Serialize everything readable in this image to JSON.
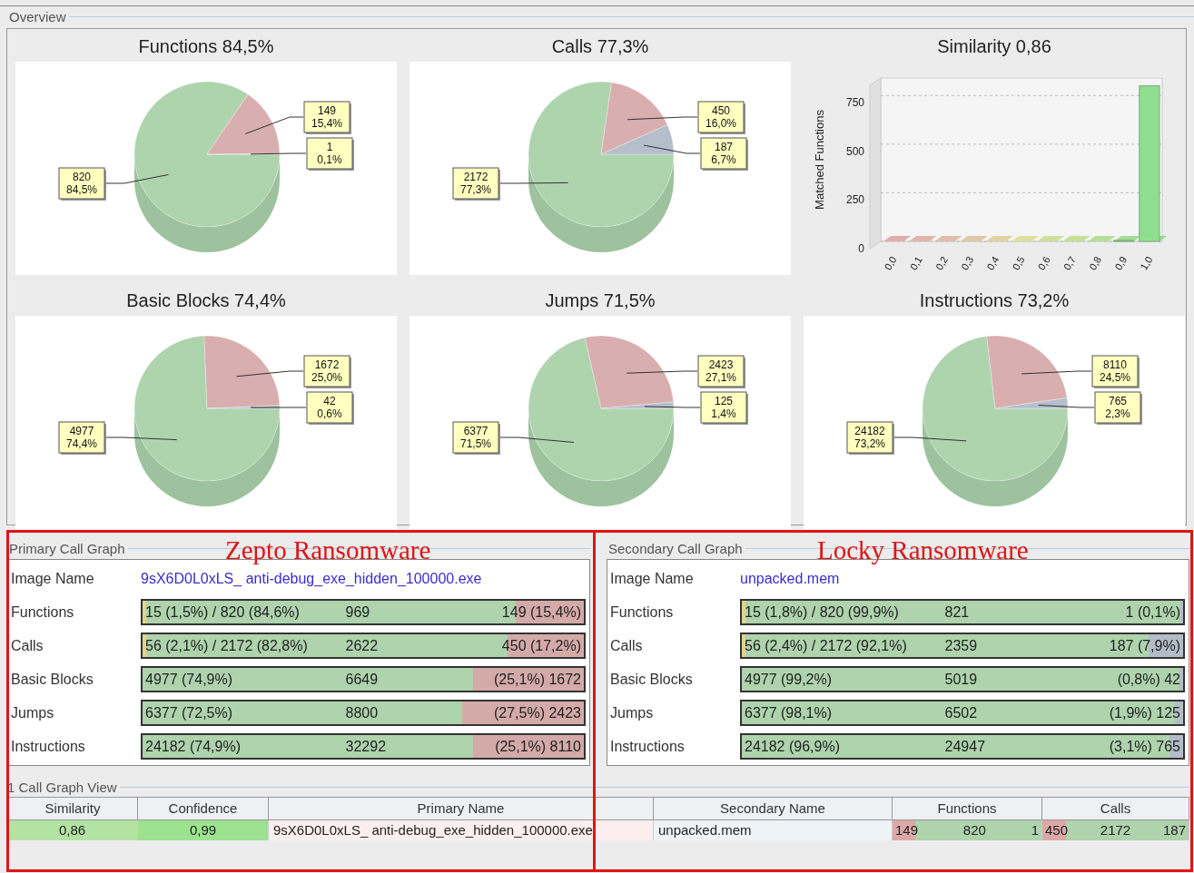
{
  "overview": {
    "title": "Overview",
    "charts": [
      {
        "chart_data": {
          "type": "pie",
          "title": "Functions 84,5%",
          "values": [
            820,
            149,
            1
          ],
          "value_labels": [
            "820\n84,5%",
            "149\n15,4%",
            "1\n0,1%"
          ]
        }
      },
      {
        "chart_data": {
          "type": "pie",
          "title": "Calls 77,3%",
          "values": [
            2172,
            450,
            187
          ],
          "value_labels": [
            "2172\n77,3%",
            "450\n16,0%",
            "187\n6,7%"
          ]
        }
      },
      {
        "chart_data": {
          "type": "bar",
          "title": "Similarity 0,86",
          "ylabel": "Matched Functions",
          "categories": [
            "0,0",
            "0,1",
            "0,2",
            "0,3",
            "0,4",
            "0,5",
            "0,6",
            "0,7",
            "0,8",
            "0,9",
            "1,0"
          ],
          "values": [
            0,
            0,
            0,
            0,
            0,
            0,
            0,
            0,
            0,
            5,
            800
          ],
          "ylim": [
            0,
            840
          ],
          "yticks": [
            0,
            250,
            500,
            750
          ],
          "grid": true
        }
      },
      {
        "chart_data": {
          "type": "pie",
          "title": "Basic Blocks 74,4%",
          "values": [
            4977,
            1672,
            42
          ],
          "value_labels": [
            "4977\n74,4%",
            "1672\n25,0%",
            "42\n0,6%"
          ]
        }
      },
      {
        "chart_data": {
          "type": "pie",
          "title": "Jumps 71,5%",
          "values": [
            6377,
            2423,
            125
          ],
          "value_labels": [
            "6377\n71,5%",
            "2423\n27,1%",
            "125\n1,4%"
          ]
        }
      },
      {
        "chart_data": {
          "type": "pie",
          "title": "Instructions 73,2%",
          "values": [
            24182,
            8110,
            765
          ],
          "value_labels": [
            "24182\n73,2%",
            "8110\n24,5%",
            "765\n2,3%"
          ]
        }
      }
    ]
  },
  "call_graphs": [
    {
      "kind": "primary",
      "title": "Primary Call Graph",
      "annotation": "Zepto Ransomware",
      "image_label": "Image Name",
      "image_name": "9sX6D0L0xLS_ anti-debug_exe_hidden_100000.exe",
      "rows": [
        {
          "label": "Functions",
          "left": "15 (1,5%) / 820 (84,6%)",
          "center": "969",
          "right": "149 (15,4%)",
          "level": 0.846,
          "marker": true
        },
        {
          "label": "Calls",
          "left": "56 (2,1%) / 2172 (82,8%)",
          "center": "2622",
          "right": "450 (17,2%)",
          "level": 0.828,
          "marker": true
        },
        {
          "label": "Basic Blocks",
          "left": "4977 (74,9%)",
          "center": "6649",
          "right": "(25,1%) 1672",
          "level": 0.749,
          "marker": false
        },
        {
          "label": "Jumps",
          "left": "6377 (72,5%)",
          "center": "8800",
          "right": "(27,5%) 2423",
          "level": 0.725,
          "marker": false
        },
        {
          "label": "Instructions",
          "left": "24182 (74,9%)",
          "center": "32292",
          "right": "(25,1%) 8110",
          "level": 0.749,
          "marker": false
        }
      ]
    },
    {
      "kind": "secondary",
      "title": "Secondary Call Graph",
      "annotation": "Locky Ransomware",
      "image_label": "Image Name",
      "image_name": "unpacked.mem",
      "rows": [
        {
          "label": "Functions",
          "left": "15 (1,8%) / 820 (99,9%)",
          "center": "821",
          "right": "1 (0,1%)",
          "level": 0.994,
          "marker": true
        },
        {
          "label": "Calls",
          "left": "56 (2,4%) / 2172 (92,1%)",
          "center": "2359",
          "right": "187 (7,9%)",
          "level": 0.921,
          "marker": true
        },
        {
          "label": "Basic Blocks",
          "left": "4977 (99,2%)",
          "center": "5019",
          "right": "(0,8%) 42",
          "level": 0.992,
          "marker": false
        },
        {
          "label": "Jumps",
          "left": "6377 (98,1%)",
          "center": "6502",
          "right": "(1,9%) 125",
          "level": 0.981,
          "marker": false
        },
        {
          "label": "Instructions",
          "left": "24182 (96,9%)",
          "center": "24947",
          "right": "(3,1%) 765",
          "level": 0.969,
          "marker": false
        }
      ]
    }
  ],
  "call_graph_view": {
    "title": "1 Call Graph View",
    "columns": [
      "Similarity",
      "Confidence",
      "Primary Name",
      "Secondary Name",
      "Functions",
      "Calls"
    ],
    "rows": [
      {
        "similarity": "0,86",
        "confidence": "0,99",
        "primary_name": "9sX6D0L0xLS_ anti-debug_exe_hidden_100000.exe",
        "secondary_name": "unpacked.mem",
        "functions": {
          "values": [
            "149",
            "820",
            "1"
          ],
          "level": 0.154
        },
        "calls": {
          "values": [
            "450",
            "2172",
            "187"
          ],
          "level": 0.16
        }
      }
    ]
  }
}
